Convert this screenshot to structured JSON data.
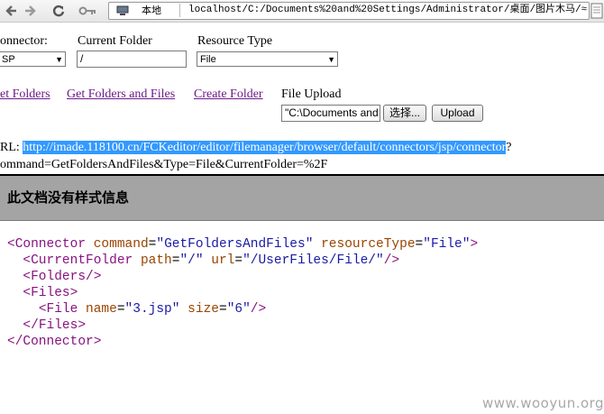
{
  "browser": {
    "security_label": "本地",
    "address": "localhost/C:/Documents%20and%20Settings/Administrator/桌面/图片木马/≈"
  },
  "form": {
    "connector_label": "onnector:",
    "connector_value": "SP",
    "current_folder_label": "Current Folder",
    "current_folder_value": "/",
    "resource_type_label": "Resource Type",
    "resource_type_value": "File",
    "links": {
      "get_folders": "et Folders",
      "get_folders_and_files": "Get Folders and Files",
      "create_folder": "Create Folder"
    },
    "file_upload_label": "File Upload",
    "file_path_value": "\"C:\\Documents and",
    "browse_button": "选择...",
    "upload_button": "Upload"
  },
  "request": {
    "url_label": "RL:",
    "url": "http://imade.118100.cn/FCKeditor/editor/filemanager/browser/default/connectors/jsp/connector",
    "url_suffix": "?",
    "command_line": "ommand=GetFoldersAndFiles&Type=File&CurrentFolder=%2F"
  },
  "notice": "此文档没有样式信息",
  "xml": {
    "connector_tag": "Connector",
    "command_attr": "command",
    "command_val": "GetFoldersAndFiles",
    "resource_attr": "resourceType",
    "resource_val": "File",
    "current_folder_tag": "CurrentFolder",
    "path_attr": "path",
    "path_val": "/",
    "url_attr": "url",
    "url_val": "/UserFiles/File/",
    "folders_tag": "Folders",
    "files_tag": "Files",
    "file_tag": "File",
    "name_attr": "name",
    "name_val": "3.jsp",
    "size_attr": "size",
    "size_val": "6"
  },
  "watermark": "www.wooyun.org"
}
